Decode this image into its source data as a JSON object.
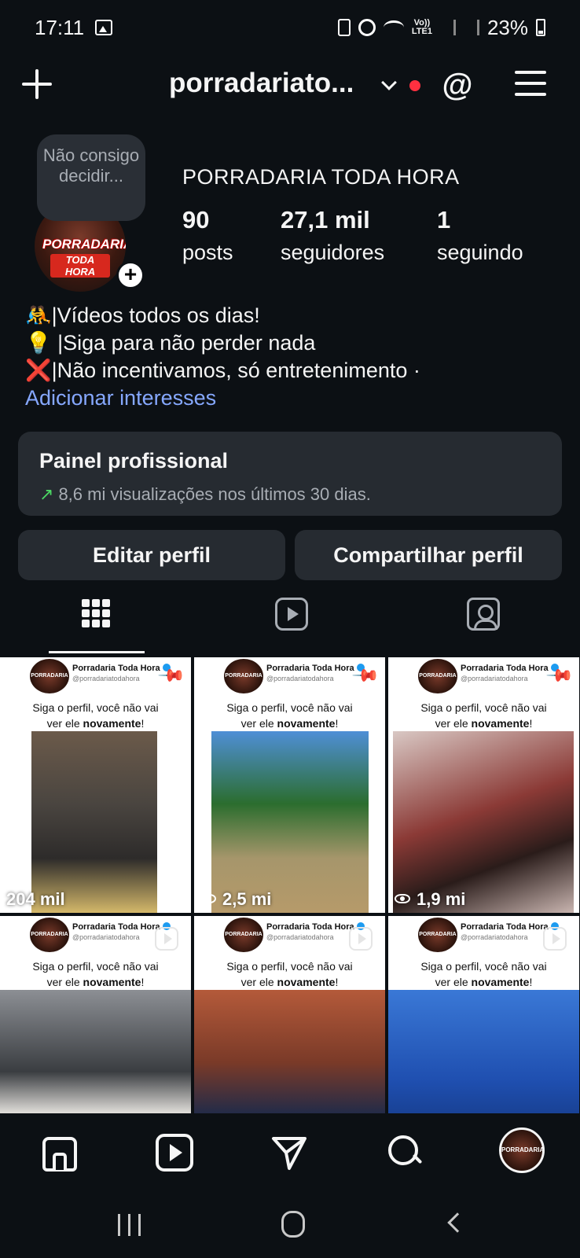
{
  "status_bar": {
    "time": "17:11",
    "network_top": "Vo))",
    "network_bottom": "LTE1",
    "battery": "23%"
  },
  "header": {
    "username": "porradariato...",
    "icons": [
      "plus-icon",
      "chevron-down-icon",
      "threads-icon",
      "menu-icon"
    ]
  },
  "profile": {
    "note": "Não consigo decidir...",
    "avatar_text_1": "PORRADARIA",
    "avatar_text_2": "TODA HORA",
    "full_name": "PORRADARIA TODA HORA",
    "stats": [
      {
        "value": "90",
        "label": "posts"
      },
      {
        "value": "27,1 mil",
        "label": "seguidores"
      },
      {
        "value": "1",
        "label": "seguindo"
      }
    ],
    "bio": [
      "🤼|Vídeos todos os dias!",
      "💡 |Siga para não perder nada",
      "❌|Não incentivamos, só entretenimento ·"
    ],
    "bio_link": "Adicionar interesses"
  },
  "dashboard": {
    "title": "Painel profissional",
    "arrow": "↗",
    "subtitle": "8,6 mi visualizações nos últimos 30 dias."
  },
  "actions": {
    "edit": "Editar perfil",
    "share": "Compartilhar perfil"
  },
  "tabs": [
    "grid-icon",
    "reels-icon",
    "tagged-icon"
  ],
  "post_header": {
    "name": "Porradaria Toda Hora",
    "handle": "@porradariatodahora",
    "avatar_text": "PORRADARIA",
    "caption_line1": "Siga o perfil, você não vai",
    "caption_line2_pre": "ver ele ",
    "caption_bold": "novamente",
    "caption_end": "!"
  },
  "posts": [
    {
      "views": "204 mil",
      "eye": false
    },
    {
      "views": "2,5 mi",
      "eye": true
    },
    {
      "views": "1,9 mi",
      "eye": true
    },
    {
      "views": "",
      "eye": false
    },
    {
      "views": "",
      "eye": false
    },
    {
      "views": "",
      "eye": false
    }
  ],
  "bottom_nav": {
    "items": [
      "home-icon",
      "reels-icon",
      "send-icon",
      "search-icon",
      "profile-avatar"
    ],
    "profile_text": "PORRADARIA"
  },
  "colors": {
    "background": "#0c1014",
    "card": "#262b31",
    "link": "#86a8ff",
    "notification": "#ff3040",
    "trend": "#4cd964",
    "verified": "#1d9bf0"
  }
}
